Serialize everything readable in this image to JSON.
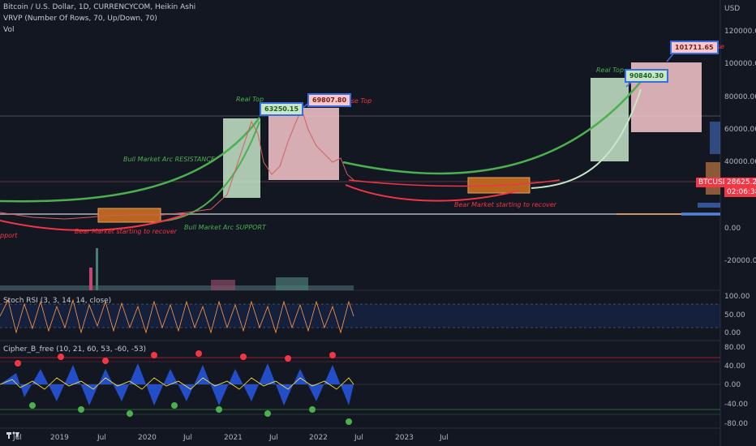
{
  "header": {
    "title": "Bitcoin / U.S. Dollar, 1D, CURRENCYCOM, Heikin Ashi",
    "indicator_vrvp": "VRVP (Number Of Rows, 70, Up/Down, 70)",
    "indicator_vol": "Vol"
  },
  "price_axis": {
    "currency": "USD",
    "ticks": [
      "120000.00",
      "100000.00",
      "80000.00",
      "60000.00",
      "40000.00",
      "20000.00",
      "0.00",
      "-20000.00"
    ]
  },
  "last_price": {
    "symbol": "BTCUSD",
    "price": "28625.20",
    "countdown": "02:06:38"
  },
  "annotations": {
    "real_top_1": "Real Top",
    "real_top_2": "Real Top",
    "false_top_1": "False Top",
    "false_top_2": "False",
    "bull_resistance": "Bull Market Arc RESISTANCE",
    "bull_support": "Bull Market Arc SUPPORT",
    "bear_recover_1": "Bear Market starting to recover",
    "bear_recover_2": "Bear Market starting to recover",
    "support_cut": "pport"
  },
  "callouts": {
    "c1": "63250.15",
    "c2": "69807.80",
    "c3": "90840.30",
    "c4": "101711.65"
  },
  "stoch": {
    "label": "Stoch RSI (3, 3, 14, 14, close)",
    "ticks": [
      "100.00",
      "50.00",
      "0.00"
    ]
  },
  "cipher": {
    "label": "Cipher_B_free (10, 21, 60, 53, -60, -53)",
    "ticks": [
      "80.00",
      "40.00",
      "0.00",
      "-40.00",
      "-80.00"
    ]
  },
  "time_axis": {
    "ticks": [
      "Jul",
      "2019",
      "Jul",
      "2020",
      "Jul",
      "2021",
      "Jul",
      "2022",
      "Jul",
      "2023",
      "Jul"
    ]
  },
  "colors": {
    "background": "#131722",
    "green_arc": "#4caf50",
    "red_arc": "#f23645",
    "callout_border": "#3a6ee0",
    "orange_box": "#b8651f",
    "green_box": "#c8e6c9",
    "pink_box": "#f8c8cc"
  },
  "icons": {
    "flag": "tv-logo-icon"
  }
}
